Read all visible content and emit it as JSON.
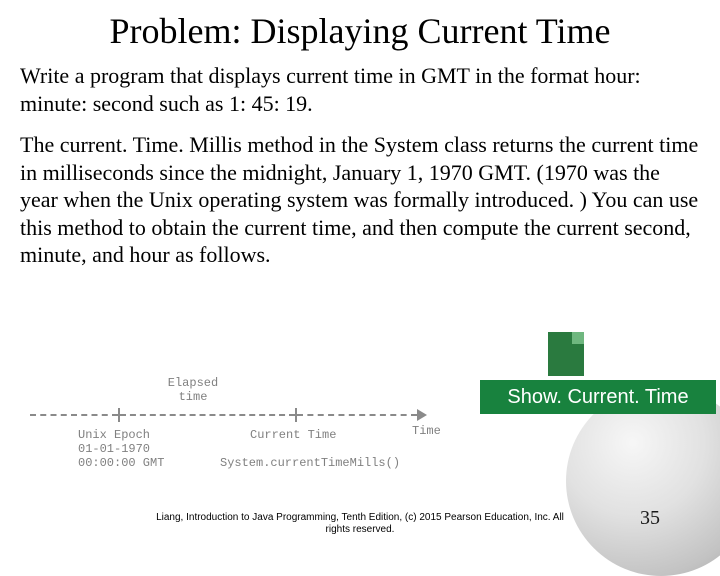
{
  "title": "Problem: Displaying Current Time",
  "para1": "Write a program that displays current time in GMT in the format hour: minute: second such as 1: 45: 19.",
  "para2": "The current. Time. Millis method in the System class returns the current time in milliseconds since the midnight, January 1, 1970 GMT. (1970 was the year when the Unix operating system was formally introduced. ) You can use this method to obtain the current time, and then compute the current second, minute, and hour as follows.",
  "diagram": {
    "elapsed_time": "Elapsed\ntime",
    "unix_epoch": "Unix Epoch",
    "unix_epoch_date": "01-01-1970",
    "unix_epoch_time": "00:00:00 GMT",
    "current_time": "Current Time",
    "time_label": "Time",
    "method": "System.currentTimeMills()"
  },
  "button_label": "Show. Current. Time",
  "footer_line1": "Liang, Introduction to Java Programming, Tenth Edition, (c) 2015 Pearson Education, Inc. All",
  "footer_line2": "rights reserved.",
  "page_number": "35"
}
